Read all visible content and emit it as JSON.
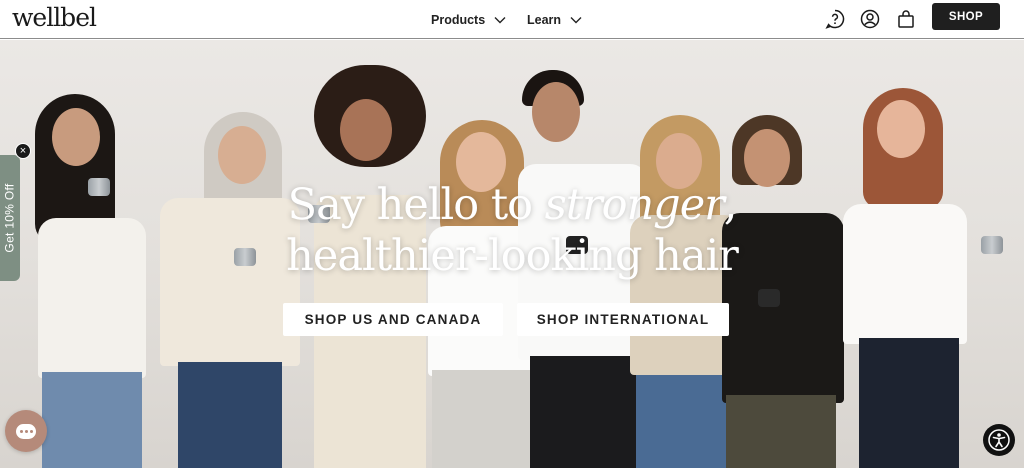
{
  "header": {
    "logo": "wellbel",
    "nav": [
      {
        "label": "Products",
        "icon": "chevron-down-icon"
      },
      {
        "label": "Learn",
        "icon": "chevron-down-icon"
      }
    ],
    "icons": [
      "help-icon",
      "account-icon",
      "cart-icon"
    ],
    "shop_label": "SHOP"
  },
  "hero": {
    "headline_part1": "Say hello to ",
    "headline_emphasis": "stronger",
    "headline_comma": ",",
    "headline_line2": "healthier-looking hair",
    "cta_primary": "SHOP US AND CANADA",
    "cta_secondary": "SHOP INTERNATIONAL"
  },
  "side_tab": {
    "label": "Get 10% Off",
    "close": "×"
  },
  "widgets": {
    "chat_icon": "chat-icon",
    "accessibility_icon": "accessibility-icon"
  },
  "colors": {
    "header_bg": "#ffffff",
    "shop_btn": "#1f1f1f",
    "side_tab": "#7e8f83",
    "chat_btn": "#b58a7a"
  }
}
